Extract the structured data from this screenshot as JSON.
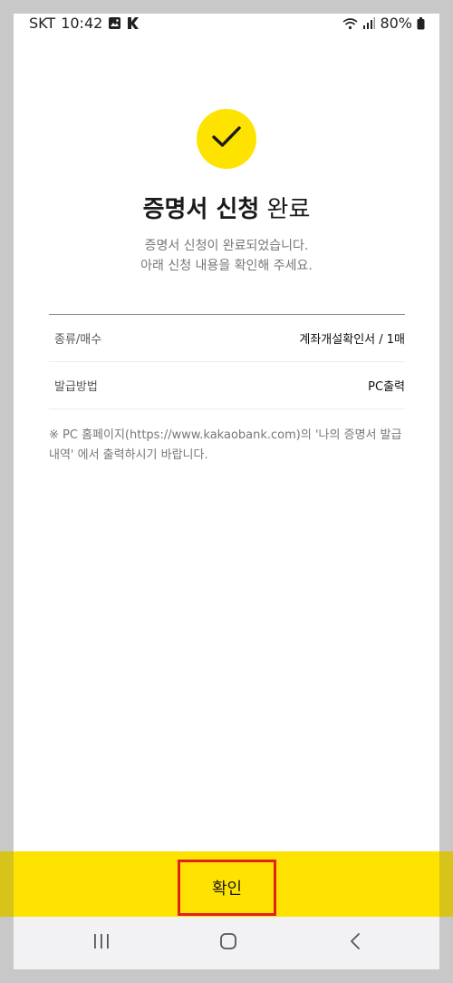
{
  "status_bar": {
    "carrier": "SKT",
    "time": "10:42",
    "battery": "80%"
  },
  "header": {
    "title_bold": "증명서 신청",
    "title_regular": "완료",
    "subtitle_line1": "증명서 신청이 완료되었습니다.",
    "subtitle_line2": "아래 신청 내용을 확인해 주세요."
  },
  "details": [
    {
      "label": "종류/매수",
      "value": "계좌개설확인서 / 1매"
    },
    {
      "label": "발급방법",
      "value": "PC출력"
    }
  ],
  "note": "※ PC 홈페이지(https://www.kakaobank.com)의 '나의 증명서 발급내역' 에서 출력하시기 바랍니다.",
  "confirm_button": {
    "label": "확인"
  },
  "colors": {
    "accent": "#ffe300",
    "highlight_border": "#e22020"
  },
  "icons": [
    "check-icon",
    "gallery-icon",
    "kakao-k-icon",
    "wifi-icon",
    "signal-icon",
    "battery-icon",
    "recents-icon",
    "home-icon",
    "back-icon"
  ]
}
